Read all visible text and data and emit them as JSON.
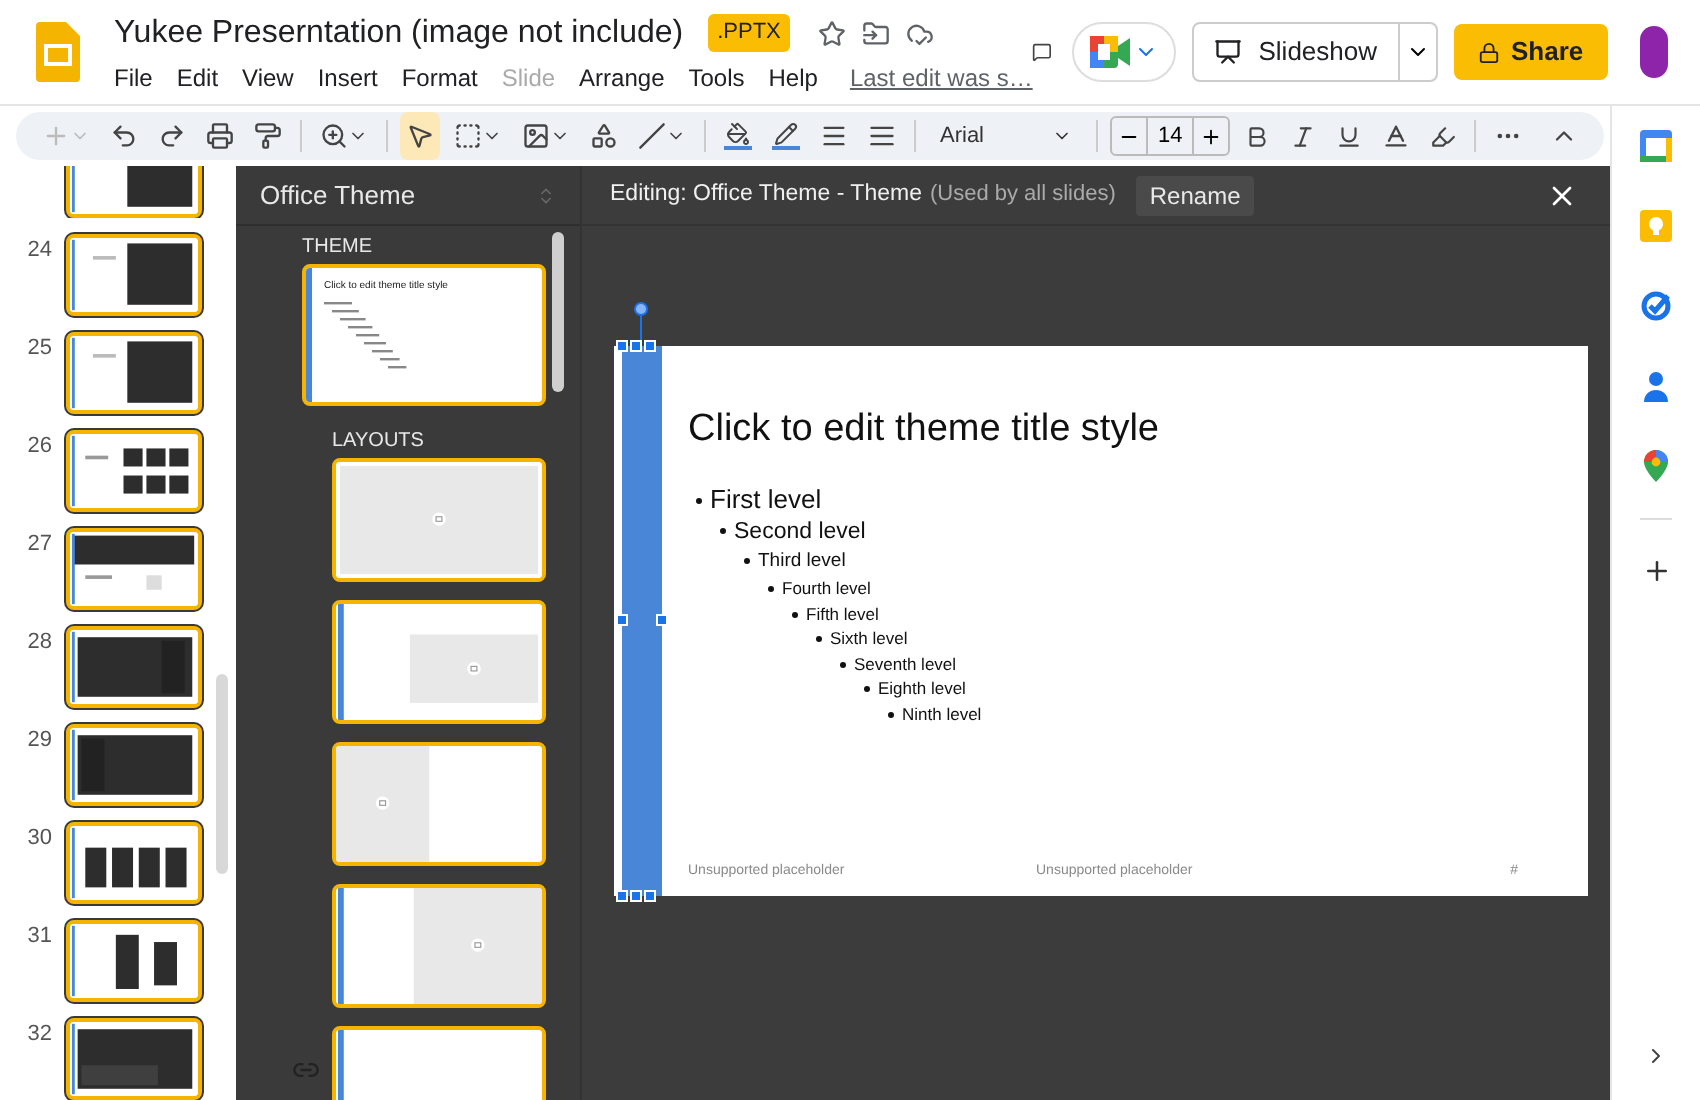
{
  "header": {
    "title": "Yukee Preserntation (image not include)",
    "badge": ".PPTX",
    "menu": [
      {
        "label": "File",
        "disabled": false
      },
      {
        "label": "Edit",
        "disabled": false
      },
      {
        "label": "View",
        "disabled": false
      },
      {
        "label": "Insert",
        "disabled": false
      },
      {
        "label": "Format",
        "disabled": false
      },
      {
        "label": "Slide",
        "disabled": true
      },
      {
        "label": "Arrange",
        "disabled": false
      },
      {
        "label": "Tools",
        "disabled": false
      },
      {
        "label": "Help",
        "disabled": false
      }
    ],
    "last_edit": "Last edit was s…",
    "slideshow": "Slideshow",
    "share": "Share"
  },
  "toolbar": {
    "new_slide": {
      "disabled": true
    },
    "tools": [
      {
        "kind": "select",
        "selected": true
      },
      {
        "kind": "textbox",
        "selected": false
      },
      {
        "kind": "image",
        "selected": false
      },
      {
        "kind": "shape",
        "selected": false
      },
      {
        "kind": "line",
        "selected": false
      }
    ],
    "font": "Arial",
    "font_size": "14"
  },
  "filmstrip": {
    "slides": [
      {
        "selected": true
      },
      {
        "number": "24",
        "selected": true
      },
      {
        "number": "25",
        "selected": true
      },
      {
        "number": "26",
        "selected": true
      },
      {
        "number": "27",
        "selected": true
      },
      {
        "number": "28",
        "selected": true
      },
      {
        "number": "29",
        "selected": true
      },
      {
        "number": "30",
        "selected": true
      },
      {
        "number": "31",
        "selected": true
      },
      {
        "number": "32",
        "selected": true
      }
    ]
  },
  "theme_panel": {
    "title": "Office Theme",
    "theme_heading": "THEME",
    "theme_thumbnail": {
      "title": "Click to edit theme title style",
      "selected": true
    },
    "layouts_heading": "LAYOUTS",
    "layouts": [
      {
        "kind": "picture-full",
        "selected": true
      },
      {
        "kind": "picture-right",
        "selected": true
      },
      {
        "kind": "picture-left",
        "selected": true
      },
      {
        "kind": "picture-right-wide",
        "selected": true
      },
      {
        "kind": "blank",
        "selected": true
      }
    ]
  },
  "editor": {
    "heading": "Editing: Office Theme - Theme",
    "note": "(Used by all slides)",
    "rename": "Rename",
    "slide": {
      "title": "Click to edit theme title style",
      "levels": [
        {
          "text": "First level",
          "children": [
            {
              "text": "Second level",
              "children": [
                {
                  "text": "Third level",
                  "children": [
                    {
                      "text": "Fourth level",
                      "children": [
                        {
                          "text": "Fifth level",
                          "children": [
                            {
                              "text": "Sixth level",
                              "children": [
                                {
                                  "text": "Seventh level",
                                  "children": [
                                    {
                                      "text": "Eighth level",
                                      "children": [
                                        {
                                          "text": "Ninth level"
                                        }
                                      ]
                                    }
                                  ]
                                }
                              ]
                            }
                          ]
                        }
                      ]
                    }
                  ]
                }
              ]
            }
          ]
        }
      ],
      "footer_left": "Unsupported placeholder",
      "footer_center": "Unsupported placeholder",
      "slide_number": "#"
    }
  }
}
